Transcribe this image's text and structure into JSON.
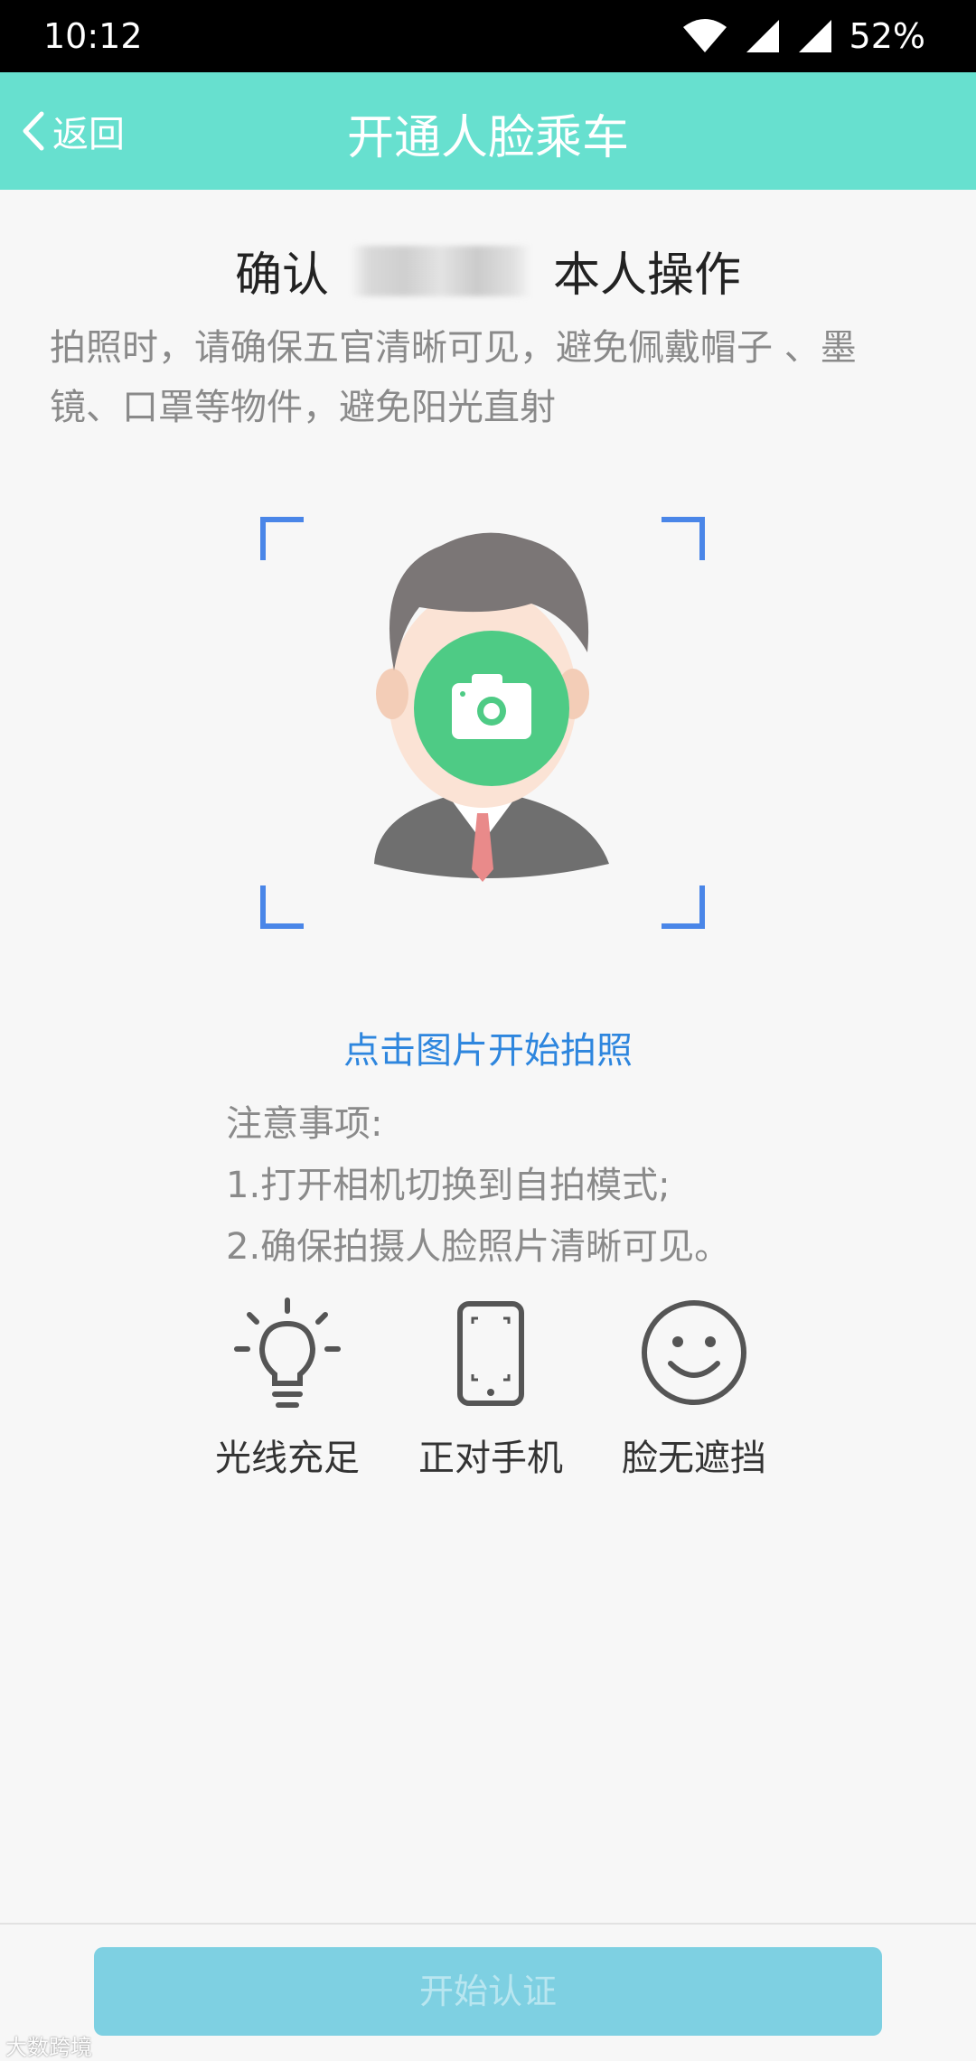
{
  "status_bar": {
    "time": "10:12",
    "battery": "52%"
  },
  "nav": {
    "back_label": "返回",
    "title": "开通人脸乘车"
  },
  "confirm": {
    "prefix": "确认",
    "suffix": "本人操作"
  },
  "instructions": "拍照时，请确保五官清晰可见，避免佩戴帽子 、墨镜、口罩等物件，避免阳光直射",
  "photo": {
    "hint": "点击图片开始拍照"
  },
  "notes": {
    "title": "注意事项:",
    "items": [
      "1.打开相机切换到自拍模式;",
      "2.确保拍摄人脸照片清晰可见。"
    ]
  },
  "tips": [
    {
      "label": "光线充足",
      "icon": "lightbulb-icon"
    },
    {
      "label": "正对手机",
      "icon": "phone-icon"
    },
    {
      "label": "脸无遮挡",
      "icon": "smiley-face-icon"
    }
  ],
  "button": {
    "label": "开始认证"
  },
  "watermark": "大数跨境",
  "colors": {
    "nav_bg": "#67e0cf",
    "accent_blue": "#2e86de",
    "camera_green": "#4ecb85",
    "button_bg": "#7ed0e2"
  }
}
